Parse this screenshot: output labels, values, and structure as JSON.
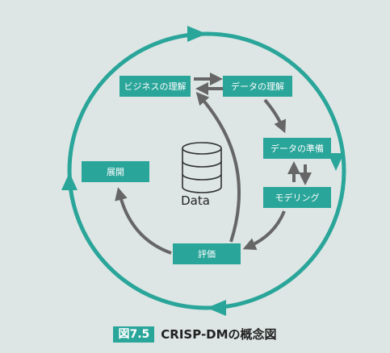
{
  "diagram": {
    "center_label": "Data",
    "phases": {
      "business_understanding": "ビジネスの理解",
      "data_understanding": "データの理解",
      "data_preparation": "データの準備",
      "modeling": "モデリング",
      "evaluation": "評価",
      "deployment": "展開"
    }
  },
  "caption": {
    "figure_number": "図7.5",
    "title": "CRISP-DMの概念図"
  },
  "colors": {
    "background": "#dde6e4",
    "accent": "#2aa59a",
    "arrow_gray": "#666666"
  }
}
